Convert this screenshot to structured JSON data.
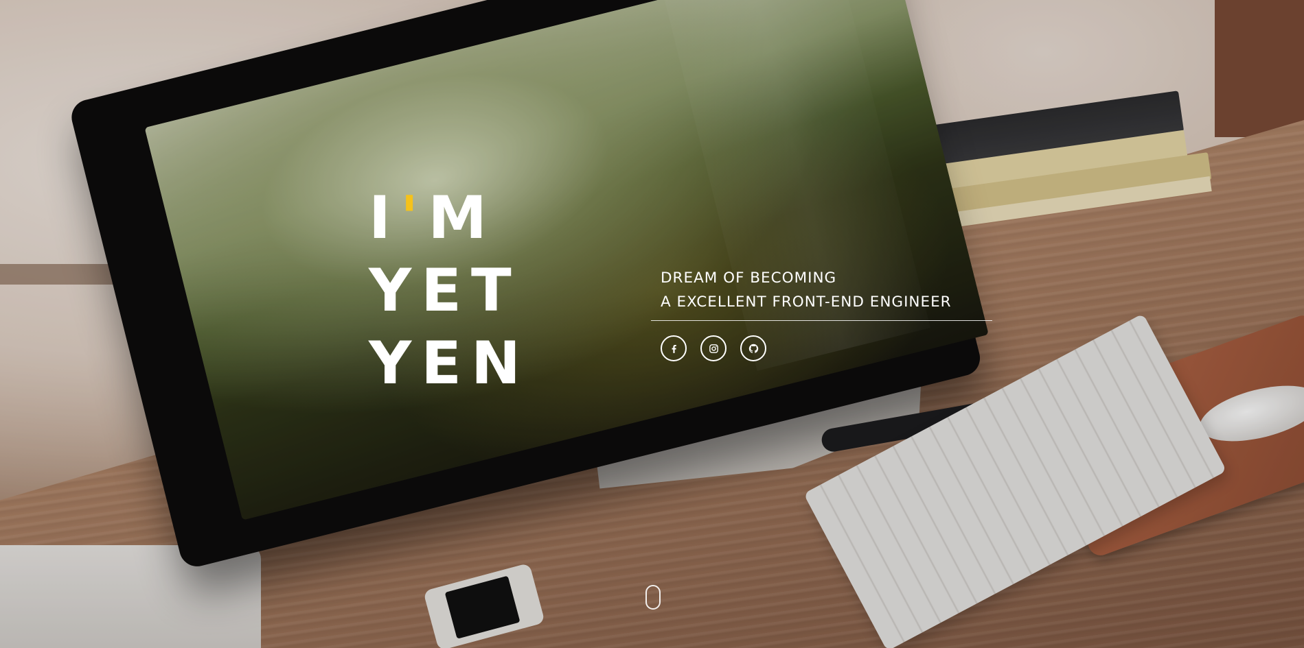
{
  "hero": {
    "title_lines": [
      {
        "pre": "I",
        "accent": "'",
        "post": "M"
      },
      {
        "text": "YET"
      },
      {
        "text": "YEN"
      }
    ],
    "accent_color": "#f5c21b"
  },
  "tagline": {
    "line1": "DREAM OF BECOMING",
    "line2": "A EXCELLENT FRONT-END ENGINEER"
  },
  "social": {
    "links": [
      {
        "icon": "facebook-icon"
      },
      {
        "icon": "instagram-icon"
      },
      {
        "icon": "github-icon"
      }
    ]
  },
  "scroll_indicator": {
    "icon": "mouse-scroll-icon"
  }
}
